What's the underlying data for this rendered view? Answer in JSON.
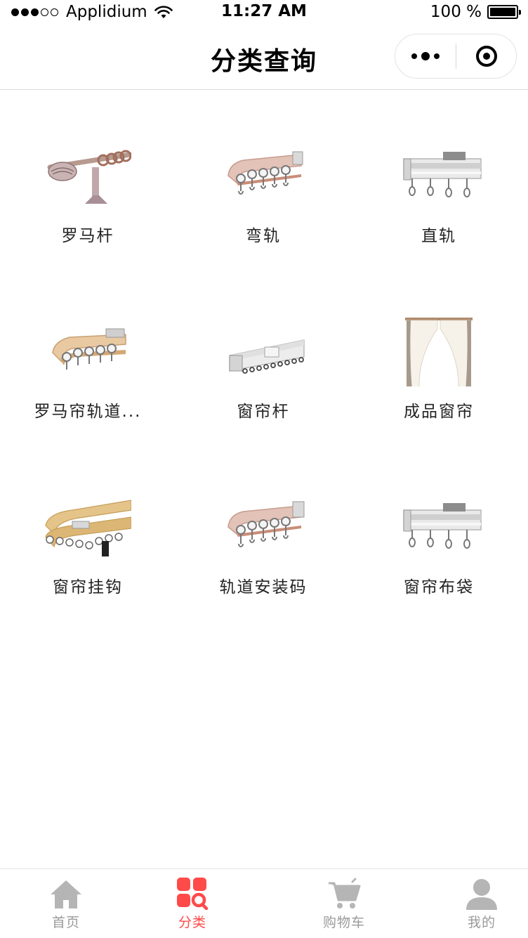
{
  "status_bar": {
    "carrier": "Applidium",
    "time": "11:27 AM",
    "battery": "100 %"
  },
  "nav": {
    "title": "分类查询"
  },
  "categories": [
    {
      "label": "罗马杆",
      "icon": "roman-rod-image"
    },
    {
      "label": "弯轨",
      "icon": "curved-track-image"
    },
    {
      "label": "直轨",
      "icon": "straight-track-image"
    },
    {
      "label": "罗马帘轨道...",
      "icon": "roman-blind-track-image"
    },
    {
      "label": "窗帘杆",
      "icon": "curtain-rod-image"
    },
    {
      "label": "成品窗帘",
      "icon": "finished-curtain-image"
    },
    {
      "label": "窗帘挂钩",
      "icon": "curtain-hook-image"
    },
    {
      "label": "轨道安装码",
      "icon": "track-bracket-image"
    },
    {
      "label": "窗帘布袋",
      "icon": "curtain-bag-image"
    }
  ],
  "tab_bar": {
    "tabs": [
      {
        "label": "首页",
        "icon": "home-icon"
      },
      {
        "label": "分类",
        "icon": "category-search-icon"
      },
      {
        "label": "购物车",
        "icon": "cart-icon"
      },
      {
        "label": "我的",
        "icon": "user-icon"
      }
    ],
    "active_index": 1,
    "active_color": "#ff4a4a",
    "inactive_color": "#9a9a9a"
  }
}
